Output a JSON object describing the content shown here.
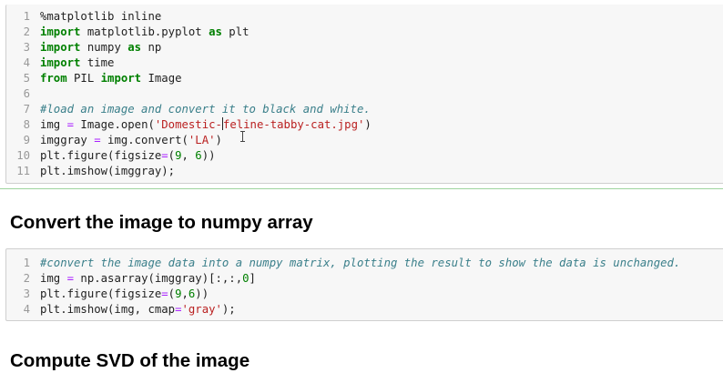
{
  "cells": [
    {
      "lines": [
        {
          "n": "1",
          "tokens": [
            [
              "magic",
              "%matplotlib inline"
            ]
          ]
        },
        {
          "n": "2",
          "tokens": [
            [
              "kw",
              "import"
            ],
            [
              "txt",
              " matplotlib.pyplot "
            ],
            [
              "kw",
              "as"
            ],
            [
              "txt",
              " plt"
            ]
          ]
        },
        {
          "n": "3",
          "tokens": [
            [
              "kw",
              "import"
            ],
            [
              "txt",
              " numpy "
            ],
            [
              "kw",
              "as"
            ],
            [
              "txt",
              " np"
            ]
          ]
        },
        {
          "n": "4",
          "tokens": [
            [
              "kw",
              "import"
            ],
            [
              "txt",
              " time"
            ]
          ]
        },
        {
          "n": "5",
          "tokens": [
            [
              "kw",
              "from"
            ],
            [
              "txt",
              " PIL "
            ],
            [
              "kw",
              "import"
            ],
            [
              "txt",
              " Image"
            ]
          ]
        },
        {
          "n": "6",
          "tokens": []
        },
        {
          "n": "7",
          "tokens": [
            [
              "com",
              "#load an image and convert it to black and white."
            ]
          ]
        },
        {
          "n": "8",
          "tokens": [
            [
              "txt",
              "img "
            ],
            [
              "op",
              "="
            ],
            [
              "txt",
              " Image.open("
            ],
            [
              "str",
              "'Domestic-"
            ],
            [
              "cursor",
              ""
            ],
            [
              "str",
              "feline-tabby-cat.jpg'"
            ],
            [
              "txt",
              ")"
            ]
          ]
        },
        {
          "n": "9",
          "tokens": [
            [
              "txt",
              "imggray "
            ],
            [
              "op",
              "="
            ],
            [
              "txt",
              " img.convert("
            ],
            [
              "str",
              "'LA'"
            ],
            [
              "txt",
              ")"
            ]
          ]
        },
        {
          "n": "10",
          "tokens": [
            [
              "txt",
              "plt.figure(figsize"
            ],
            [
              "op",
              "="
            ],
            [
              "txt",
              "("
            ],
            [
              "num",
              "9"
            ],
            [
              "txt",
              ", "
            ],
            [
              "num",
              "6"
            ],
            [
              "txt",
              "))"
            ]
          ]
        },
        {
          "n": "11",
          "tokens": [
            [
              "txt",
              "plt.imshow(imggray);"
            ]
          ]
        }
      ]
    },
    {
      "lines": [
        {
          "n": "1",
          "tokens": [
            [
              "com",
              "#convert the image data into a numpy matrix, plotting the result to show the data is unchanged."
            ]
          ]
        },
        {
          "n": "2",
          "tokens": [
            [
              "txt",
              "img "
            ],
            [
              "op",
              "="
            ],
            [
              "txt",
              " np.asarray(imggray)[:,:,"
            ],
            [
              "num",
              "0"
            ],
            [
              "txt",
              "]"
            ]
          ]
        },
        {
          "n": "3",
          "tokens": [
            [
              "txt",
              "plt.figure(figsize"
            ],
            [
              "op",
              "="
            ],
            [
              "txt",
              "("
            ],
            [
              "num",
              "9"
            ],
            [
              "txt",
              ","
            ],
            [
              "num",
              "6"
            ],
            [
              "txt",
              "))"
            ]
          ]
        },
        {
          "n": "4",
          "tokens": [
            [
              "txt",
              "plt.imshow(img, cmap"
            ],
            [
              "op",
              "="
            ],
            [
              "str",
              "'gray'"
            ],
            [
              "txt",
              ");"
            ]
          ]
        }
      ]
    }
  ],
  "headings": {
    "h1": "Convert the image to numpy array",
    "h2": "Compute SVD of the image"
  },
  "colors": {
    "keyword": "#008000",
    "string": "#ba2121",
    "comment": "#3a7f8a",
    "operator": "#aa22ff",
    "cell_bg": "#f7f7f7",
    "divider": "#9ed49e"
  }
}
